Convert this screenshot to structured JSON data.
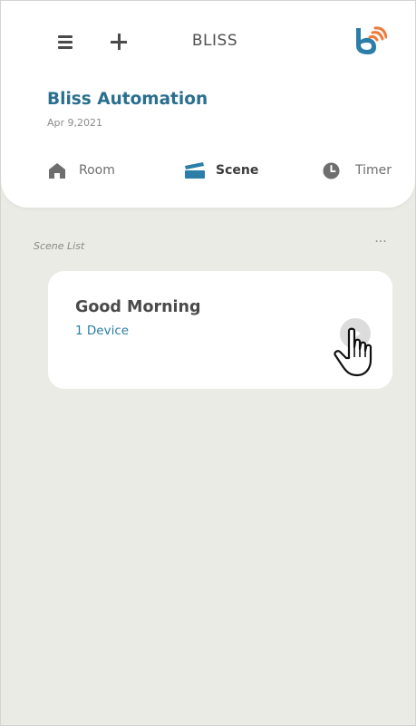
{
  "app": {
    "title": "BLISS",
    "brand": "Bliss Automation",
    "date": "Apr 9,2021",
    "colors": {
      "brand_blue": "#2a6f8e",
      "link_blue": "#2a7ea8",
      "logo_orange": "#f07a3a",
      "background": "#ebebe6",
      "card": "#ffffff"
    }
  },
  "toolbar": {
    "menu_icon": "hamburger-menu-icon",
    "add_icon": "plus-icon",
    "logo_icon": "bliss-logo-icon"
  },
  "tabs": [
    {
      "label": "Room",
      "icon": "home-icon",
      "active": false
    },
    {
      "label": "Scene",
      "icon": "clapperboard-icon",
      "active": true
    },
    {
      "label": "Timer",
      "icon": "clock-icon",
      "active": false
    }
  ],
  "scene_list": {
    "label": "Scene List",
    "more_icon": "more-dots-icon",
    "items": [
      {
        "name": "Good Morning",
        "device_count": "1 Device",
        "action_icon": "play-icon"
      }
    ]
  },
  "cursor": {
    "icon": "hand-pointer-cursor-icon"
  }
}
